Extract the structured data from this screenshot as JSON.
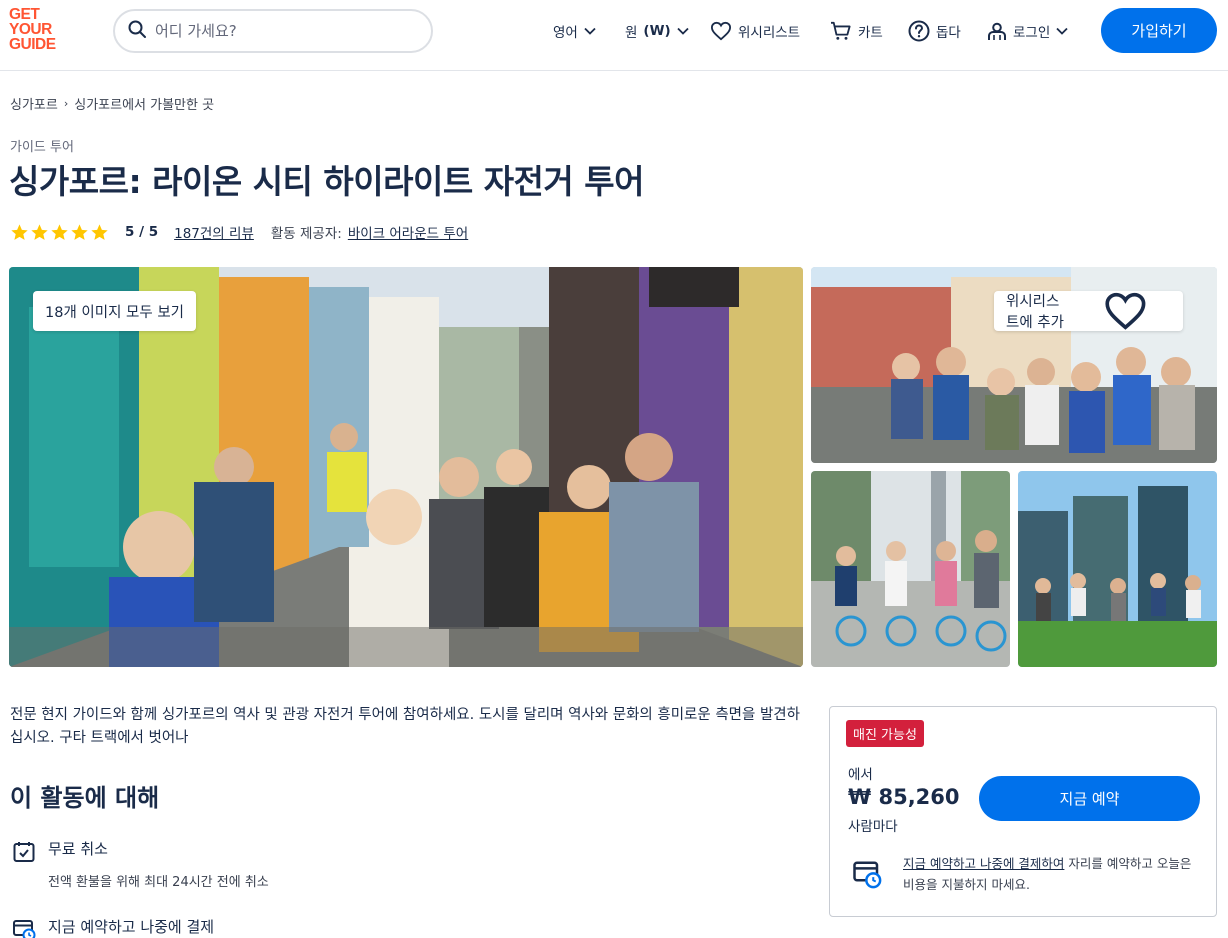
{
  "header": {
    "logo_lines": [
      "GET",
      "YOUR",
      "GUIDE"
    ],
    "search_placeholder": "어디 가세요?",
    "language": "영어",
    "currency": "원",
    "currency_code": "(W)",
    "wishlist": "위시리스트",
    "cart": "카트",
    "help": "돕다",
    "login": "로그인",
    "signup": "가입하기"
  },
  "breadcrumb": [
    "싱가포르",
    "싱가포르에서 가볼만한 곳"
  ],
  "category": "가이드 투어",
  "title": "싱가포르: 라이온 시티 하이라이트 자전거 투어",
  "rating": {
    "stars": 5,
    "score": "5 / 5",
    "reviews": "187건의 리뷰",
    "provider_label": "활동 제공자:",
    "provider": "바이크 어라운드 투어"
  },
  "gallery": {
    "view_all": "18개 이미지 모두 보기",
    "add_wishlist": "위시리스트에 추가"
  },
  "description": "전문 현지 가이드와 함께 싱가포르의 역사 및 관광 자전거 투어에 참여하세요. 도시를 달리며 역사와 문화의 흥미로운 측면을 발견하십시오. 구타 트랙에서 벗어나",
  "about_title": "이 활동에 대해",
  "features": [
    {
      "title": "무료 취소",
      "subtitle": "전액 환불을 위해 최대 24시간 전에 취소"
    },
    {
      "title": "지금 예약하고 나중에 결제"
    }
  ],
  "booking": {
    "badge": "매진 가능성",
    "from": "에서",
    "price": "₩ 85,260",
    "per": "사람마다",
    "button": "지금 예약",
    "rnpl_link": "지금 예약하고 나중에 결제하여",
    "rnpl_text": " 자리를 예약하고 오늘은 비용을 지불하지 마세요."
  },
  "colors": {
    "brand": "#ff5533",
    "primary": "#0071eb",
    "badge": "#d3203c",
    "star": "#ffc600",
    "text": "#1a2b49"
  }
}
